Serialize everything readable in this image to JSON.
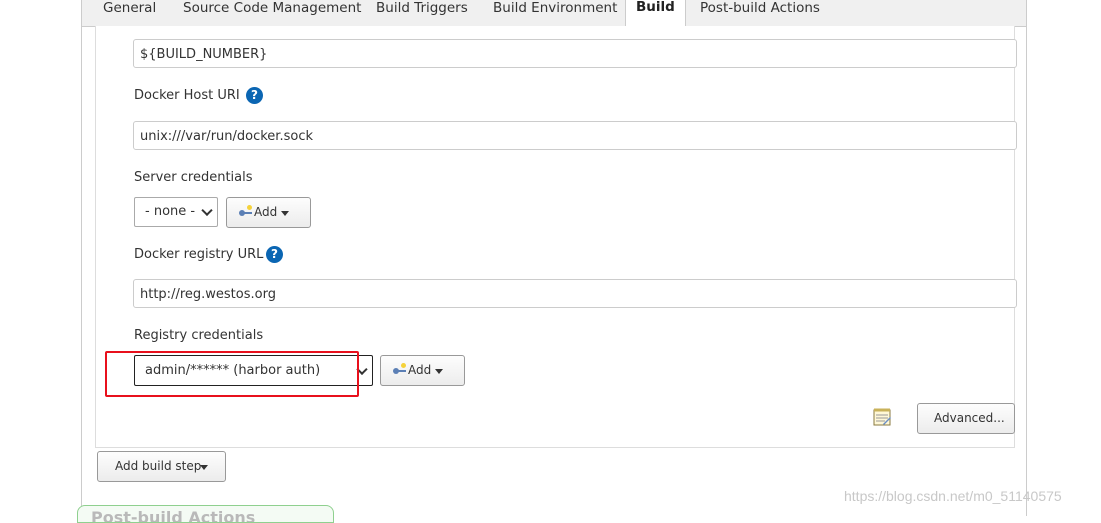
{
  "tabs": [
    {
      "label": "General",
      "active": false
    },
    {
      "label": "Source Code Management",
      "active": false
    },
    {
      "label": "Build Triggers",
      "active": false
    },
    {
      "label": "Build Environment",
      "active": false
    },
    {
      "label": "Build",
      "active": true
    },
    {
      "label": "Post-build Actions",
      "active": false
    }
  ],
  "form": {
    "tag_value": "${BUILD_NUMBER}",
    "docker_host_uri_label": "Docker Host URI",
    "docker_host_uri_value": "unix:///var/run/docker.sock",
    "server_credentials_label": "Server credentials",
    "server_credentials_selected": "- none -",
    "add_label": "Add",
    "docker_registry_url_label": "Docker registry URL",
    "docker_registry_url_value": "http://reg.westos.org",
    "registry_credentials_label": "Registry credentials",
    "registry_credentials_selected": "admin/****** (harbor auth)",
    "advanced_label": "Advanced...",
    "help_glyph": "?"
  },
  "add_build_step_label": "Add build step",
  "post_build_header": "Post-build Actions",
  "watermark": "https://blog.csdn.net/m0_51140575",
  "colors": {
    "highlight": "#e8101c",
    "help_icon": "#0b66b3"
  }
}
